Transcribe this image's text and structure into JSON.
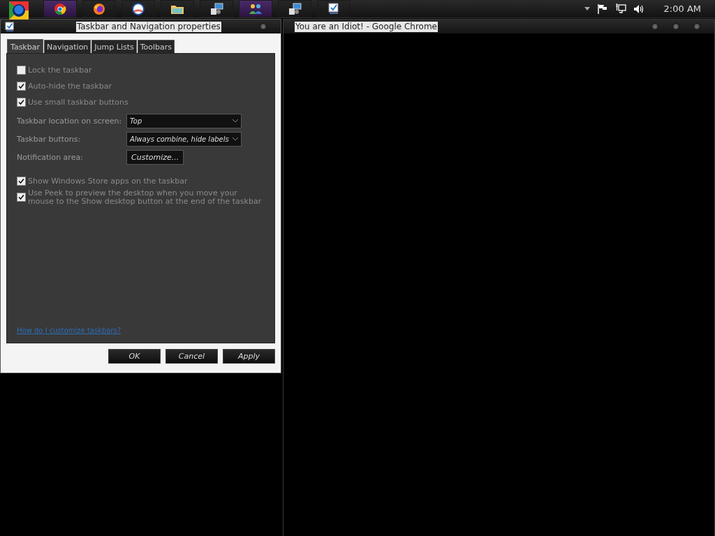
{
  "taskbar": {
    "buttons": [
      {
        "kind": "browser",
        "highlighted": true
      },
      {
        "kind": "fox",
        "highlighted": false
      },
      {
        "kind": "emblem",
        "highlighted": false
      },
      {
        "kind": "folder",
        "highlighted": false
      },
      {
        "kind": "installer",
        "highlighted": false
      },
      {
        "kind": "people",
        "highlighted": true
      },
      {
        "kind": "installer",
        "highlighted": false
      },
      {
        "kind": "checklist",
        "highlighted": false
      }
    ],
    "clock": "2:00 AM"
  },
  "dialog": {
    "title": "Taskbar and Navigation properties",
    "tabs": [
      {
        "label": "Taskbar",
        "selected": true
      },
      {
        "label": "Navigation",
        "selected": false
      },
      {
        "label": "Jump Lists",
        "selected": false
      },
      {
        "label": "Toolbars",
        "selected": false
      }
    ],
    "options_top": [
      {
        "label": "Lock the taskbar",
        "checked": false
      },
      {
        "label": "Auto-hide the taskbar",
        "checked": true
      },
      {
        "label": "Use small taskbar buttons",
        "checked": true
      }
    ],
    "settings": [
      {
        "kind": "dropdown",
        "label": "Taskbar location on screen:",
        "value": "Top"
      },
      {
        "kind": "dropdown",
        "label": "Taskbar buttons:",
        "value": "Always combine, hide labels"
      },
      {
        "kind": "button",
        "label": "Notification area:",
        "value": "Customize..."
      }
    ],
    "options_bottom": [
      {
        "label": "Show Windows Store apps on the taskbar",
        "checked": true
      },
      {
        "label": "Use Peek to preview the desktop when you move your mouse to the Show desktop button at the end of the taskbar",
        "checked": true
      }
    ],
    "help_link": "How do I customize taskbars?",
    "buttons": [
      "OK",
      "Cancel",
      "Apply"
    ]
  },
  "browser_window": {
    "title": "You are an Idiot! - Google Chrome"
  }
}
